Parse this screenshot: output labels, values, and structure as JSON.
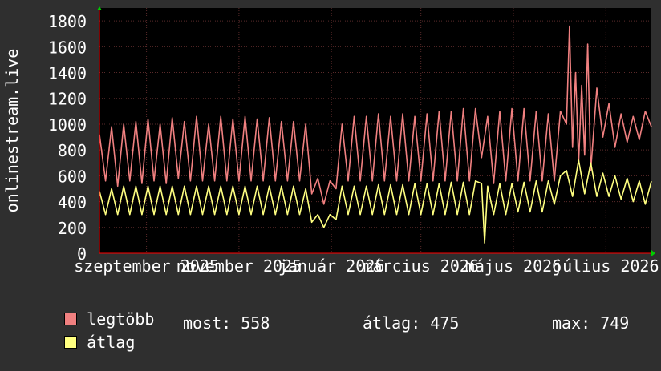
{
  "chart_data": {
    "type": "line",
    "ylabel": "onlinestream.live",
    "ylim": [
      0,
      1900
    ],
    "yticks": [
      0,
      200,
      400,
      600,
      800,
      1000,
      1200,
      1400,
      1600,
      1800
    ],
    "grid": true,
    "x": {
      "range": [
        "2025-08-01",
        "2026-07-31"
      ],
      "ticks": [
        {
          "label": "szeptember 2025",
          "date": "2025-09-01"
        },
        {
          "label": "november 2025",
          "date": "2025-11-01"
        },
        {
          "label": "január 2026",
          "date": "2026-01-01"
        },
        {
          "label": "március 2026",
          "date": "2026-03-01"
        },
        {
          "label": "május 2026",
          "date": "2026-05-01"
        },
        {
          "label": "július 2026",
          "date": "2026-07-01"
        }
      ]
    },
    "series": [
      {
        "name": "legtöbb",
        "color": "#f08080",
        "points": [
          [
            "2025-08-01",
            920
          ],
          [
            "2025-08-05",
            560
          ],
          [
            "2025-08-09",
            980
          ],
          [
            "2025-08-13",
            520
          ],
          [
            "2025-08-17",
            1000
          ],
          [
            "2025-08-21",
            560
          ],
          [
            "2025-08-25",
            1020
          ],
          [
            "2025-08-29",
            540
          ],
          [
            "2025-09-02",
            1040
          ],
          [
            "2025-09-06",
            560
          ],
          [
            "2025-09-10",
            1000
          ],
          [
            "2025-09-14",
            540
          ],
          [
            "2025-09-18",
            1050
          ],
          [
            "2025-09-22",
            580
          ],
          [
            "2025-09-26",
            1020
          ],
          [
            "2025-09-30",
            560
          ],
          [
            "2025-10-04",
            1060
          ],
          [
            "2025-10-08",
            560
          ],
          [
            "2025-10-12",
            1000
          ],
          [
            "2025-10-16",
            560
          ],
          [
            "2025-10-20",
            1060
          ],
          [
            "2025-10-24",
            560
          ],
          [
            "2025-10-28",
            1040
          ],
          [
            "2025-11-01",
            560
          ],
          [
            "2025-11-05",
            1060
          ],
          [
            "2025-11-09",
            560
          ],
          [
            "2025-11-13",
            1040
          ],
          [
            "2025-11-17",
            560
          ],
          [
            "2025-11-21",
            1050
          ],
          [
            "2025-11-25",
            560
          ],
          [
            "2025-11-29",
            1020
          ],
          [
            "2025-12-03",
            560
          ],
          [
            "2025-12-07",
            1020
          ],
          [
            "2025-12-11",
            560
          ],
          [
            "2025-12-15",
            1000
          ],
          [
            "2025-12-19",
            460
          ],
          [
            "2025-12-23",
            580
          ],
          [
            "2025-12-27",
            380
          ],
          [
            "2025-12-31",
            560
          ],
          [
            "2026-01-04",
            500
          ],
          [
            "2026-01-08",
            1000
          ],
          [
            "2026-01-12",
            560
          ],
          [
            "2026-01-16",
            1060
          ],
          [
            "2026-01-20",
            560
          ],
          [
            "2026-01-24",
            1060
          ],
          [
            "2026-01-28",
            560
          ],
          [
            "2026-02-01",
            1080
          ],
          [
            "2026-02-05",
            560
          ],
          [
            "2026-02-09",
            1060
          ],
          [
            "2026-02-13",
            560
          ],
          [
            "2026-02-17",
            1080
          ],
          [
            "2026-02-21",
            560
          ],
          [
            "2026-02-25",
            1060
          ],
          [
            "2026-03-01",
            560
          ],
          [
            "2026-03-05",
            1080
          ],
          [
            "2026-03-09",
            560
          ],
          [
            "2026-03-13",
            1100
          ],
          [
            "2026-03-17",
            560
          ],
          [
            "2026-03-21",
            1100
          ],
          [
            "2026-03-25",
            560
          ],
          [
            "2026-03-29",
            1120
          ],
          [
            "2026-04-02",
            560
          ],
          [
            "2026-04-06",
            1120
          ],
          [
            "2026-04-10",
            740
          ],
          [
            "2026-04-14",
            1060
          ],
          [
            "2026-04-18",
            540
          ],
          [
            "2026-04-22",
            1100
          ],
          [
            "2026-04-26",
            560
          ],
          [
            "2026-04-30",
            1120
          ],
          [
            "2026-05-04",
            560
          ],
          [
            "2026-05-08",
            1120
          ],
          [
            "2026-05-12",
            560
          ],
          [
            "2026-05-16",
            1100
          ],
          [
            "2026-05-20",
            560
          ],
          [
            "2026-05-24",
            1080
          ],
          [
            "2026-05-28",
            560
          ],
          [
            "2026-06-01",
            1100
          ],
          [
            "2026-06-05",
            1000
          ],
          [
            "2026-06-07",
            1760
          ],
          [
            "2026-06-09",
            820
          ],
          [
            "2026-06-11",
            1400
          ],
          [
            "2026-06-13",
            700
          ],
          [
            "2026-06-15",
            1300
          ],
          [
            "2026-06-17",
            760
          ],
          [
            "2026-06-19",
            1620
          ],
          [
            "2026-06-21",
            640
          ],
          [
            "2026-06-25",
            1280
          ],
          [
            "2026-06-29",
            900
          ],
          [
            "2026-07-03",
            1160
          ],
          [
            "2026-07-07",
            820
          ],
          [
            "2026-07-11",
            1080
          ],
          [
            "2026-07-15",
            860
          ],
          [
            "2026-07-19",
            1060
          ],
          [
            "2026-07-23",
            880
          ],
          [
            "2026-07-27",
            1100
          ],
          [
            "2026-07-31",
            980
          ]
        ]
      },
      {
        "name": "átlag",
        "color": "#ffff80",
        "points": [
          [
            "2025-08-01",
            480
          ],
          [
            "2025-08-05",
            300
          ],
          [
            "2025-08-09",
            500
          ],
          [
            "2025-08-13",
            300
          ],
          [
            "2025-08-17",
            520
          ],
          [
            "2025-08-21",
            300
          ],
          [
            "2025-08-25",
            520
          ],
          [
            "2025-08-29",
            300
          ],
          [
            "2025-09-02",
            520
          ],
          [
            "2025-09-06",
            300
          ],
          [
            "2025-09-10",
            520
          ],
          [
            "2025-09-14",
            300
          ],
          [
            "2025-09-18",
            520
          ],
          [
            "2025-09-22",
            300
          ],
          [
            "2025-09-26",
            520
          ],
          [
            "2025-09-30",
            300
          ],
          [
            "2025-10-04",
            520
          ],
          [
            "2025-10-08",
            300
          ],
          [
            "2025-10-12",
            520
          ],
          [
            "2025-10-16",
            300
          ],
          [
            "2025-10-20",
            520
          ],
          [
            "2025-10-24",
            300
          ],
          [
            "2025-10-28",
            520
          ],
          [
            "2025-11-01",
            300
          ],
          [
            "2025-11-05",
            520
          ],
          [
            "2025-11-09",
            300
          ],
          [
            "2025-11-13",
            520
          ],
          [
            "2025-11-17",
            300
          ],
          [
            "2025-11-21",
            520
          ],
          [
            "2025-11-25",
            300
          ],
          [
            "2025-11-29",
            520
          ],
          [
            "2025-12-03",
            300
          ],
          [
            "2025-12-07",
            520
          ],
          [
            "2025-12-11",
            300
          ],
          [
            "2025-12-15",
            500
          ],
          [
            "2025-12-19",
            240
          ],
          [
            "2025-12-23",
            300
          ],
          [
            "2025-12-27",
            200
          ],
          [
            "2025-12-31",
            300
          ],
          [
            "2026-01-04",
            260
          ],
          [
            "2026-01-08",
            520
          ],
          [
            "2026-01-12",
            300
          ],
          [
            "2026-01-16",
            520
          ],
          [
            "2026-01-20",
            300
          ],
          [
            "2026-01-24",
            520
          ],
          [
            "2026-01-28",
            300
          ],
          [
            "2026-02-01",
            530
          ],
          [
            "2026-02-05",
            300
          ],
          [
            "2026-02-09",
            530
          ],
          [
            "2026-02-13",
            300
          ],
          [
            "2026-02-17",
            530
          ],
          [
            "2026-02-21",
            300
          ],
          [
            "2026-02-25",
            540
          ],
          [
            "2026-03-01",
            300
          ],
          [
            "2026-03-05",
            540
          ],
          [
            "2026-03-09",
            300
          ],
          [
            "2026-03-13",
            540
          ],
          [
            "2026-03-17",
            300
          ],
          [
            "2026-03-21",
            550
          ],
          [
            "2026-03-25",
            300
          ],
          [
            "2026-03-29",
            550
          ],
          [
            "2026-04-02",
            300
          ],
          [
            "2026-04-06",
            560
          ],
          [
            "2026-04-10",
            540
          ],
          [
            "2026-04-12",
            80
          ],
          [
            "2026-04-14",
            520
          ],
          [
            "2026-04-18",
            300
          ],
          [
            "2026-04-22",
            540
          ],
          [
            "2026-04-26",
            300
          ],
          [
            "2026-04-30",
            540
          ],
          [
            "2026-05-04",
            320
          ],
          [
            "2026-05-08",
            550
          ],
          [
            "2026-05-12",
            320
          ],
          [
            "2026-05-16",
            560
          ],
          [
            "2026-05-20",
            320
          ],
          [
            "2026-05-24",
            560
          ],
          [
            "2026-05-28",
            380
          ],
          [
            "2026-06-01",
            600
          ],
          [
            "2026-06-05",
            640
          ],
          [
            "2026-06-09",
            440
          ],
          [
            "2026-06-13",
            720
          ],
          [
            "2026-06-17",
            460
          ],
          [
            "2026-06-21",
            700
          ],
          [
            "2026-06-25",
            440
          ],
          [
            "2026-06-29",
            620
          ],
          [
            "2026-07-03",
            440
          ],
          [
            "2026-07-07",
            600
          ],
          [
            "2026-07-11",
            420
          ],
          [
            "2026-07-15",
            580
          ],
          [
            "2026-07-19",
            400
          ],
          [
            "2026-07-23",
            560
          ],
          [
            "2026-07-27",
            380
          ],
          [
            "2026-07-31",
            558
          ]
        ]
      }
    ]
  },
  "legend": {
    "max_label": "legtöbb",
    "avg_label": "átlag",
    "max_color": "#f08080",
    "avg_color": "#ffff80",
    "now_text": "most: 558",
    "mean_text": "átlag: 475",
    "peak_text": "max: 749"
  }
}
